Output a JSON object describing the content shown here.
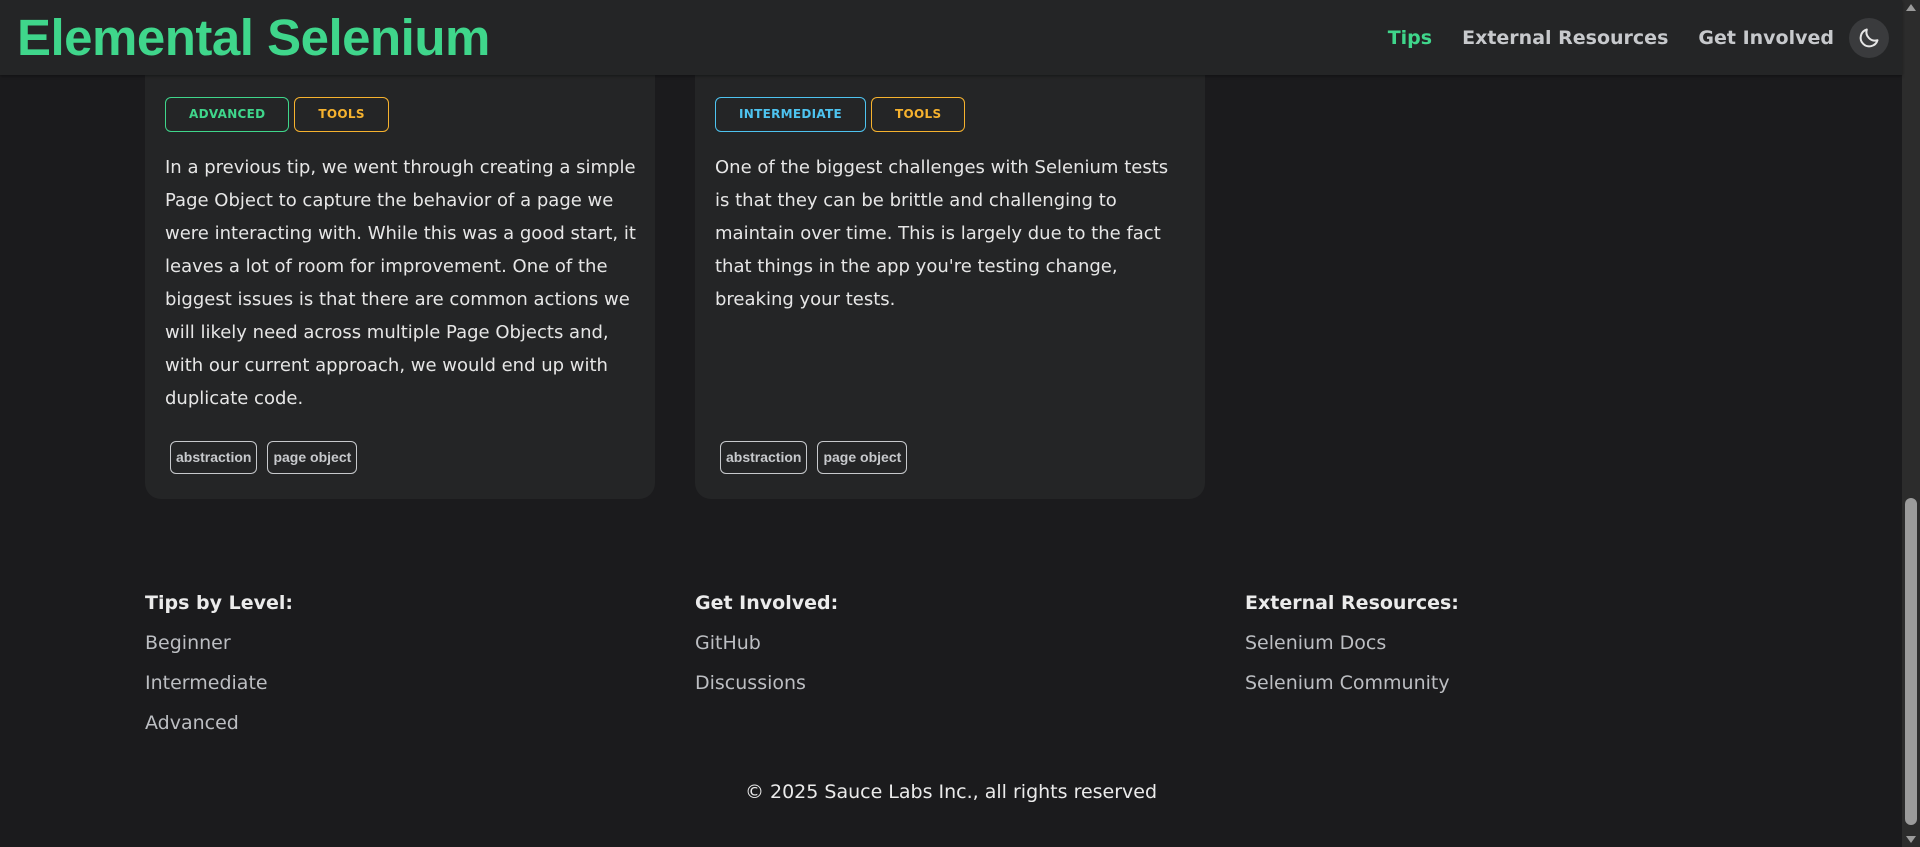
{
  "header": {
    "logo": "Elemental Selenium",
    "nav": [
      {
        "label": "Tips",
        "active": true
      },
      {
        "label": "External Resources",
        "active": false
      },
      {
        "label": "Get Involved",
        "active": false
      }
    ],
    "theme_toggle_icon": "moon-icon"
  },
  "cards": [
    {
      "levels": [
        "ADVANCED",
        "TOOLS"
      ],
      "description": "In a previous tip, we went through creating a simple Page Object to capture the behavior of a page we were interacting with. While this was a good start, it leaves a lot of room for improvement. One of the biggest issues is that there are common actions we will likely need across multiple Page Objects and, with our current approach, we would end up with duplicate code.",
      "tags": [
        "abstraction",
        "page object"
      ]
    },
    {
      "levels": [
        "INTERMEDIATE",
        "TOOLS"
      ],
      "description": "One of the biggest challenges with Selenium tests is that they can be brittle and challenging to maintain over time. This is largely due to the fact that things in the app you're testing change, breaking your tests.",
      "tags": [
        "abstraction",
        "page object"
      ]
    }
  ],
  "footer": {
    "columns": [
      {
        "title": "Tips by Level:",
        "links": [
          "Beginner",
          "Intermediate",
          "Advanced"
        ]
      },
      {
        "title": "Get Involved:",
        "links": [
          "GitHub",
          "Discussions"
        ]
      },
      {
        "title": "External Resources:",
        "links": [
          "Selenium Docs",
          "Selenium Community"
        ]
      }
    ],
    "copyright": "© 2025 Sauce Labs Inc., all rights reserved"
  },
  "colors": {
    "accent": "#3fd68b",
    "background": "#1b1b1d",
    "surface": "#242526",
    "intermediate": "#4ec4f0",
    "tools": "#f6b22e"
  }
}
